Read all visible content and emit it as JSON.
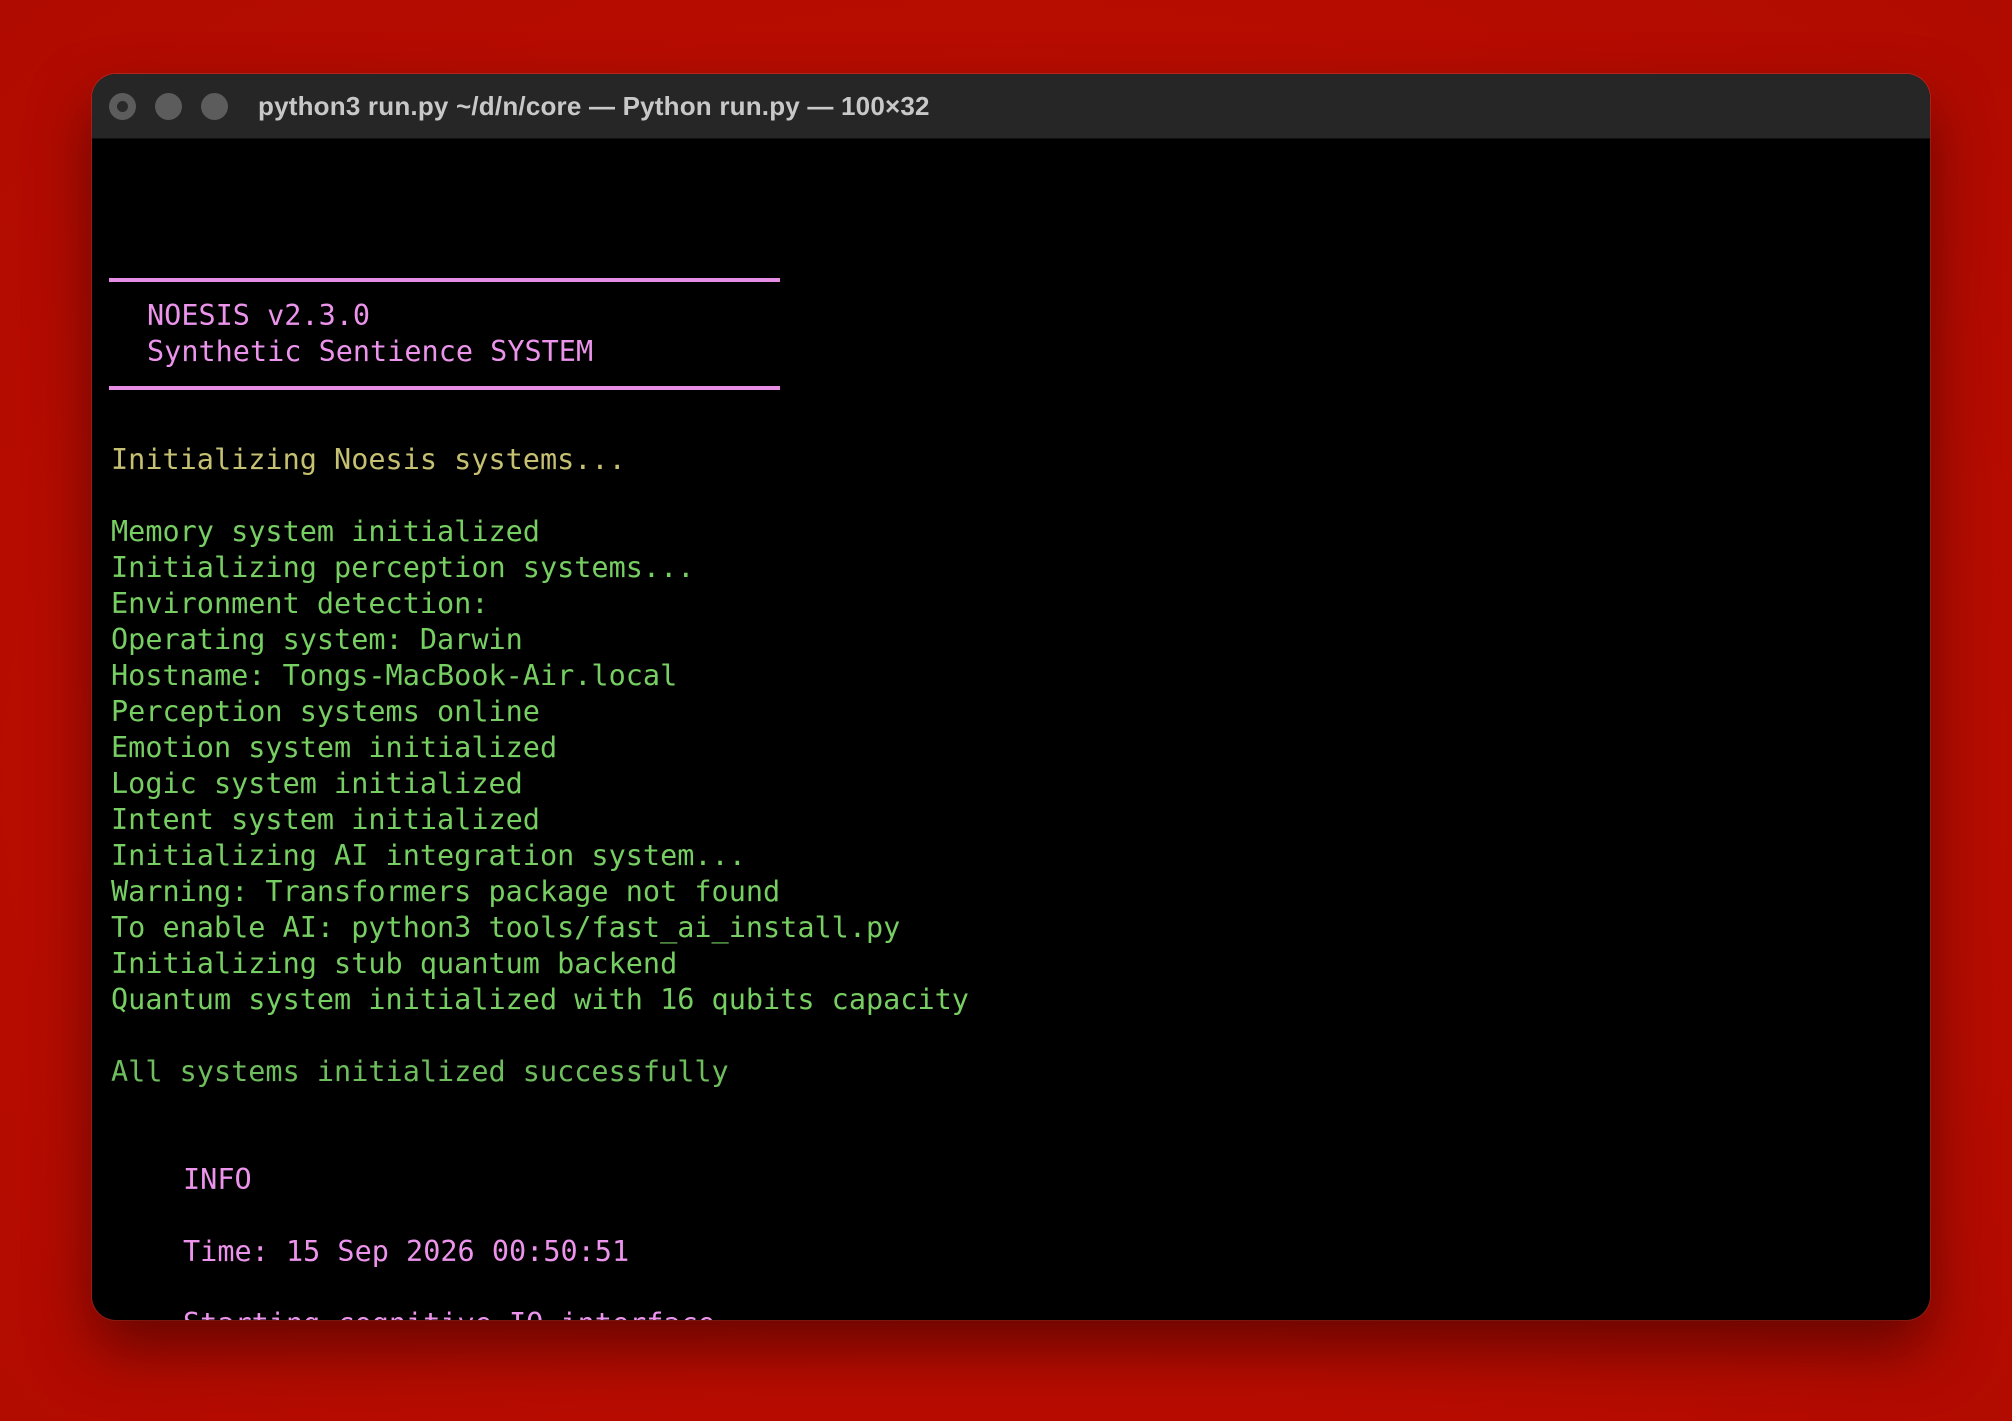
{
  "window": {
    "title": "python3 run.py ~/d/n/core — Python run.py — 100×32",
    "controls": [
      "close",
      "minimize",
      "zoom"
    ]
  },
  "terminal": {
    "banner": {
      "line1": "NOESIS v2.3.0",
      "line2": "Synthetic Sentience SYSTEM"
    },
    "initializing": "Initializing Noesis systems...",
    "log": [
      "Memory system initialized",
      "Initializing perception systems...",
      "Environment detection:",
      "Operating system: Darwin",
      "Hostname: Tongs-MacBook-Air.local",
      "Perception systems online",
      "Emotion system initialized",
      "Logic system initialized",
      "Intent system initialized",
      "Initializing AI integration system...",
      "Warning: Transformers package not found",
      "To enable AI: python3 tools/fast_ai_install.py",
      "Initializing stub quantum backend",
      "Quantum system initialized with 16 qubits capacity"
    ],
    "success": "All systems initialized successfully",
    "info": {
      "label": "INFO",
      "time": "Time: 15 Sep 2026 00:50:51",
      "starting": "Starting cognitive IO interface..."
    }
  },
  "colors": {
    "background": "#b70d00",
    "pink": "#ec93ec",
    "yellow": "#c5c072",
    "green": "#77ce62"
  }
}
